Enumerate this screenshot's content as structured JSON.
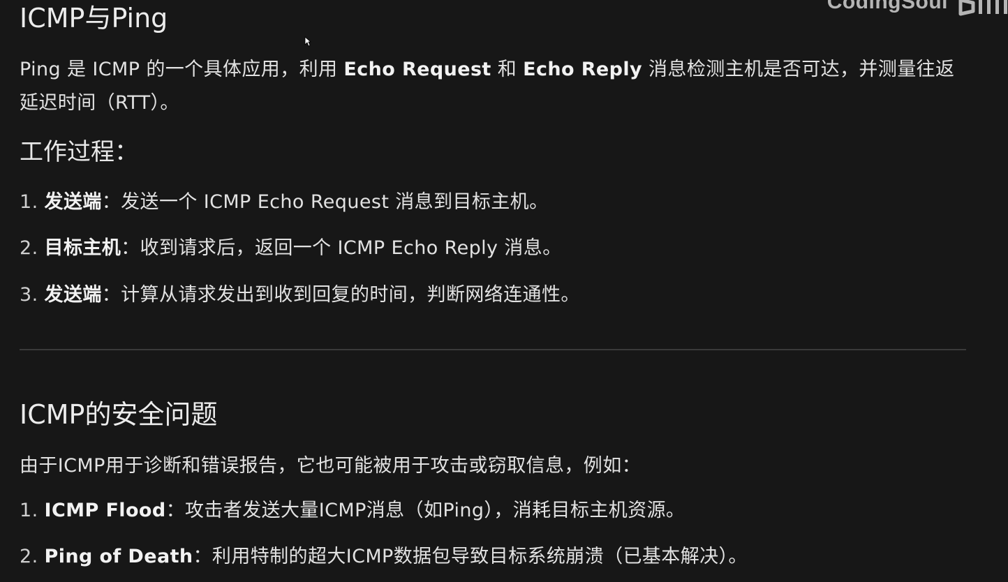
{
  "watermark": {
    "text": "CodingSoul",
    "logo_icon": "bilibili-logo-icon"
  },
  "section1": {
    "title": "ICMP与Ping",
    "intro": {
      "part1": "Ping 是 ICMP 的一个具体应用，利用 ",
      "bold1": "Echo Request",
      "part2": " 和 ",
      "bold2": "Echo Reply",
      "part3": " 消息检测主机是否可达，并测量往返延迟时间（RTT）。"
    },
    "subheading": "工作过程：",
    "steps": [
      {
        "num": "1.",
        "term": "发送端",
        "text": "：发送一个 ICMP Echo Request 消息到目标主机。"
      },
      {
        "num": "2.",
        "term": "目标主机",
        "text": "：收到请求后，返回一个 ICMP Echo Reply 消息。"
      },
      {
        "num": "3.",
        "term": "发送端",
        "text": "：计算从请求发出到收到回复的时间，判断网络连通性。"
      }
    ]
  },
  "section2": {
    "title": "ICMP的安全问题",
    "intro": "由于ICMP用于诊断和错误报告，它也可能被用于攻击或窃取信息，例如：",
    "items": [
      {
        "num": "1.",
        "term": "ICMP Flood",
        "text": "：攻击者发送大量ICMP消息（如Ping），消耗目标主机资源。"
      },
      {
        "num": "2.",
        "term": "Ping of Death",
        "text": "：利用特制的超大ICMP数据包导致目标系统崩溃（已基本解决）。"
      }
    ]
  },
  "colors": {
    "background": "#171717",
    "text": "#e2e2e2",
    "divider": "#3a3a3a"
  }
}
